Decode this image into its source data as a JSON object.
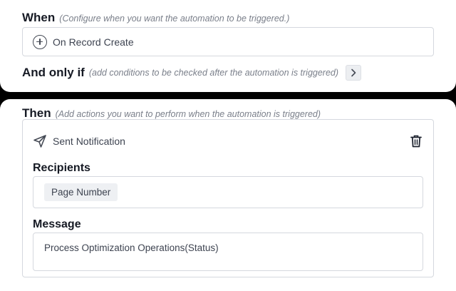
{
  "when": {
    "title": "When",
    "hint": "(Configure when you want the automation to be triggered.)",
    "trigger_label": "On Record Create"
  },
  "conditions": {
    "title": "And only if",
    "hint": "(add conditions to be checked after the automation is triggered)"
  },
  "then": {
    "title": "Then",
    "hint": "(Add actions you want to perform when the automation is triggered)",
    "action": {
      "title": "Sent Notification",
      "recipients_label": "Recipients",
      "recipients": [
        "Page Number"
      ],
      "message_label": "Message",
      "message_value": "Process Optimization Operations(Status)"
    }
  },
  "icons": {
    "trigger": "plus-circle-icon",
    "conditions_toggle": "chevron-right-icon",
    "action": "send-icon",
    "delete": "trash-icon"
  }
}
